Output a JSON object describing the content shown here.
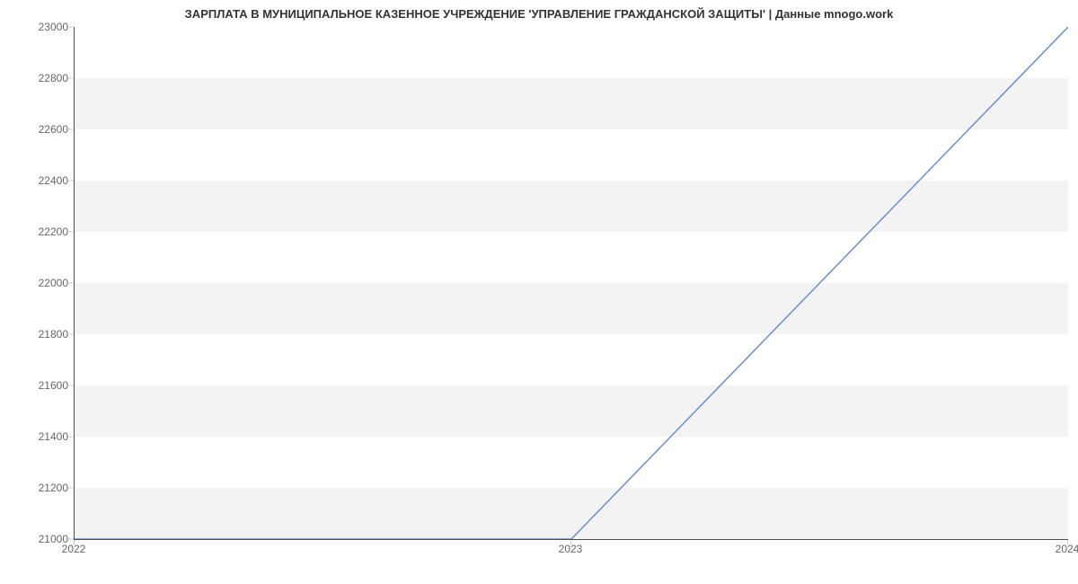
{
  "chart_data": {
    "type": "line",
    "title": "ЗАРПЛАТА В МУНИЦИПАЛЬНОЕ КАЗЕННОЕ УЧРЕЖДЕНИЕ 'УПРАВЛЕНИЕ ГРАЖДАНСКОЙ ЗАЩИТЫ' | Данные mnogo.work",
    "x": [
      2022,
      2023,
      2024
    ],
    "values": [
      21000,
      21000,
      23000
    ],
    "xlabel": "",
    "ylabel": "",
    "x_ticks": [
      2022,
      2023,
      2024
    ],
    "y_ticks": [
      21000,
      21200,
      21400,
      21600,
      21800,
      22000,
      22200,
      22400,
      22600,
      22800,
      23000
    ],
    "ylim": [
      21000,
      23000
    ],
    "xlim": [
      2022,
      2024
    ],
    "grid": "banded",
    "line_color": "#6a8fd0"
  }
}
